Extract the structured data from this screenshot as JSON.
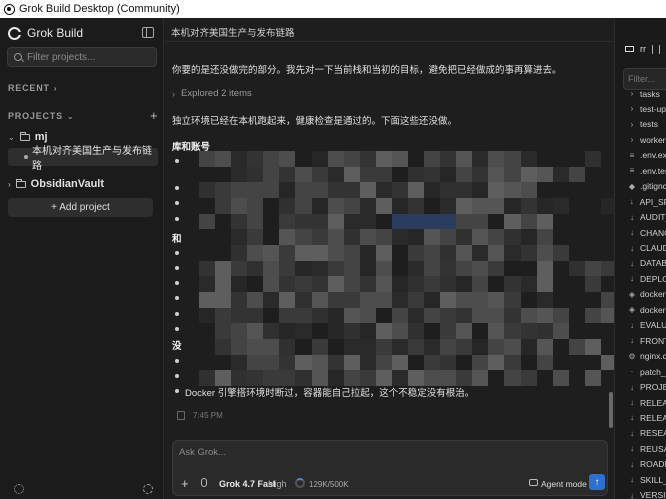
{
  "window": {
    "title": "Grok Build Desktop (Community)"
  },
  "sidebar": {
    "brand": "Grok Build",
    "filter_placeholder": "Filter projects...",
    "recent_label": "RECENT",
    "projects_label": "PROJECTS",
    "projects": [
      {
        "name": "mj",
        "chats": [
          {
            "title": "本机对齐美国生产与发布链路"
          }
        ]
      },
      {
        "name": "ObsidianVault",
        "chats": []
      }
    ],
    "add_project_label": "+ Add project"
  },
  "main": {
    "chat_title": "本机对齐美国生产与发布链路",
    "paragraph_intro": "你要的是还没做完的部分。我先对一下当前栈和当初的目标，避免把已经做成的事再算进去。",
    "explored_label": "Explored 2 items",
    "paragraph_status": "独立环境已经在本机跑起来，健康检查是通过的。下面这些还没做。",
    "heading_accounts": "库和账号",
    "heading_and": "和",
    "heading_none": "没",
    "last_item": "Docker 引擎搭环境时断过，容器能自己拉起，这个不稳定没有根治。",
    "message_time": "7:45 PM",
    "composer": {
      "placeholder": "Ask Grok...",
      "model": "Grok 4.7 Fast",
      "level": "High",
      "tokens": "129K/500K",
      "agent_mode": "Agent mode"
    }
  },
  "file_panel": {
    "tab_label": "rr",
    "filter_placeholder": "Filter...",
    "items": [
      {
        "name": "tasks",
        "type": "folder"
      },
      {
        "name": "test-up",
        "type": "folder"
      },
      {
        "name": "tests",
        "type": "folder"
      },
      {
        "name": "workers",
        "type": "folder"
      },
      {
        "name": ".env.exa",
        "type": "env"
      },
      {
        "name": ".env.tes",
        "type": "env"
      },
      {
        "name": ".gitignc",
        "type": "git"
      },
      {
        "name": "API_SPE",
        "type": "md"
      },
      {
        "name": "AUDIT_",
        "type": "md"
      },
      {
        "name": "CHANG",
        "type": "md"
      },
      {
        "name": "CLAUD",
        "type": "md"
      },
      {
        "name": "DATABA",
        "type": "md"
      },
      {
        "name": "DEPLOY",
        "type": "md"
      },
      {
        "name": "docker-",
        "type": "docker"
      },
      {
        "name": "docker-",
        "type": "docker"
      },
      {
        "name": "EVALUA",
        "type": "md"
      },
      {
        "name": "FRONTI",
        "type": "md"
      },
      {
        "name": "nginx.c",
        "type": "conf"
      },
      {
        "name": "patch_r",
        "type": "file"
      },
      {
        "name": "PROJEC",
        "type": "md"
      },
      {
        "name": "RELEAS",
        "type": "md"
      },
      {
        "name": "RELEAS",
        "type": "md"
      },
      {
        "name": "RESEAR",
        "type": "md"
      },
      {
        "name": "REUSAB",
        "type": "md"
      },
      {
        "name": "ROADM",
        "type": "md"
      },
      {
        "name": "SKILL_S",
        "type": "md"
      },
      {
        "name": "VERSIO",
        "type": "md"
      }
    ]
  }
}
